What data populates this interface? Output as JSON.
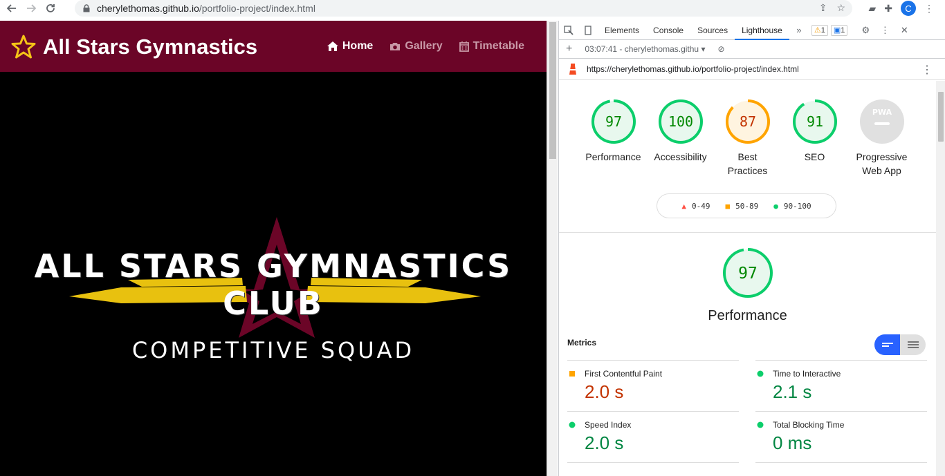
{
  "browser": {
    "url_host": "cherylethomas.github.io",
    "url_path": "/portfolio-project/index.html",
    "avatar_letter": "C"
  },
  "site": {
    "brand": "All Stars Gymnastics",
    "nav": [
      {
        "label": "Home",
        "active": true
      },
      {
        "label": "Gallery",
        "active": false
      },
      {
        "label": "Timetable",
        "active": false
      }
    ],
    "hero_title": "ALL STARS GYMNASTICS CLUB",
    "hero_subtitle": "COMPETITIVE SQUAD"
  },
  "devtools": {
    "tabs": [
      "Elements",
      "Console",
      "Sources",
      "Lighthouse"
    ],
    "active_tab": "Lighthouse",
    "warnings_count": "1",
    "issues_count": "1",
    "report_select": "03:07:41 - cherylethomas.githu",
    "report_url": "https://cherylethomas.github.io/portfolio-project/index.html",
    "scores": [
      {
        "label": "Performance",
        "value": "97",
        "color": "#0cce6b"
      },
      {
        "label": "Accessibility",
        "value": "100",
        "color": "#0cce6b"
      },
      {
        "label": "Best Practices",
        "value": "87",
        "color": "#ffa400"
      },
      {
        "label": "SEO",
        "value": "91",
        "color": "#0cce6b"
      },
      {
        "label": "Progressive Web App",
        "value": "PWA",
        "color": "#9e9e9e"
      }
    ],
    "legend": [
      {
        "range": "0-49",
        "color": "#ff4e42"
      },
      {
        "range": "50-89",
        "color": "#ffa400"
      },
      {
        "range": "90-100",
        "color": "#0cce6b"
      }
    ],
    "performance_score": "97",
    "performance_label": "Performance",
    "metrics_title": "Metrics",
    "metrics": [
      {
        "name": "First Contentful Paint",
        "value": "2.0 s",
        "status": "average"
      },
      {
        "name": "Time to Interactive",
        "value": "2.1 s",
        "status": "pass"
      },
      {
        "name": "Speed Index",
        "value": "2.0 s",
        "status": "pass"
      },
      {
        "name": "Total Blocking Time",
        "value": "0 ms",
        "status": "pass"
      }
    ]
  }
}
